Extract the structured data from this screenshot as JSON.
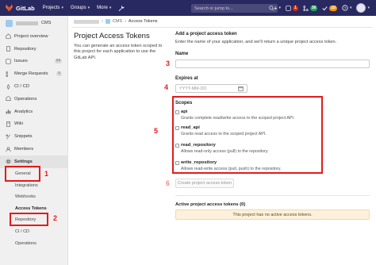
{
  "navbar": {
    "brand": "GitLab",
    "menus": [
      "Projects",
      "Groups",
      "More"
    ],
    "search_placeholder": "Search or jump to...",
    "badges": [
      {
        "label": "1",
        "color": "#dd2b0e"
      },
      {
        "label": "30",
        "color": "#1aaa55"
      },
      {
        "label": "10",
        "color": "#fc9403"
      }
    ],
    "icons": [
      "wrench-icon",
      "plus-icon",
      "merge-request-icon",
      "todo-icon",
      "help-icon",
      "avatar"
    ]
  },
  "sidebar": {
    "project_name": "CMS",
    "items": [
      {
        "label": "Project overview",
        "icon": "home-icon"
      },
      {
        "label": "Repository",
        "icon": "book-icon"
      },
      {
        "label": "Issues",
        "icon": "issues-icon",
        "count": "13"
      },
      {
        "label": "Merge Requests",
        "icon": "merge-request-icon",
        "count": "1"
      },
      {
        "label": "CI / CD",
        "icon": "rocket-icon"
      },
      {
        "label": "Operations",
        "icon": "cloud-icon"
      },
      {
        "label": "Analytics",
        "icon": "chart-icon"
      },
      {
        "label": "Wiki",
        "icon": "book-icon"
      },
      {
        "label": "Snippets",
        "icon": "snippet-icon"
      },
      {
        "label": "Members",
        "icon": "users-icon"
      },
      {
        "label": "Settings",
        "icon": "gear-icon"
      }
    ],
    "sub_items": [
      "General",
      "Integrations",
      "Webhooks",
      "Access Tokens",
      "Repository",
      "CI / CD",
      "Operations"
    ]
  },
  "breadcrumb": {
    "project": "CMS",
    "current": "Access Tokens"
  },
  "page": {
    "title": "Project Access Tokens",
    "description": "You can generate an access token scoped to this project for each application to use the GitLab API."
  },
  "form": {
    "title": "Add a project access token",
    "description": "Enter the name of your application, and we'll return a unique project access token.",
    "name_label": "Name",
    "expires_label": "Expires at",
    "expires_placeholder": "YYYY-MM-DD",
    "scopes_label": "Scopes",
    "scopes": [
      {
        "name": "api",
        "description": "Grants complete read/write access to the scoped project API."
      },
      {
        "name": "read_api",
        "description": "Grants read access to the scoped project API."
      },
      {
        "name": "read_repository",
        "description": "Allows read-only access (pull) to the repository."
      },
      {
        "name": "write_repository",
        "description": "Allows read-write access (pull, push) to the repository."
      }
    ],
    "create_button": "Create project access token"
  },
  "active_tokens": {
    "title": "Active project access tokens (0)",
    "empty_message": "This project has no active access tokens."
  },
  "annotations": [
    "1",
    "2",
    "3",
    "4",
    "5",
    "6"
  ],
  "accent_color": "#e41b1b"
}
